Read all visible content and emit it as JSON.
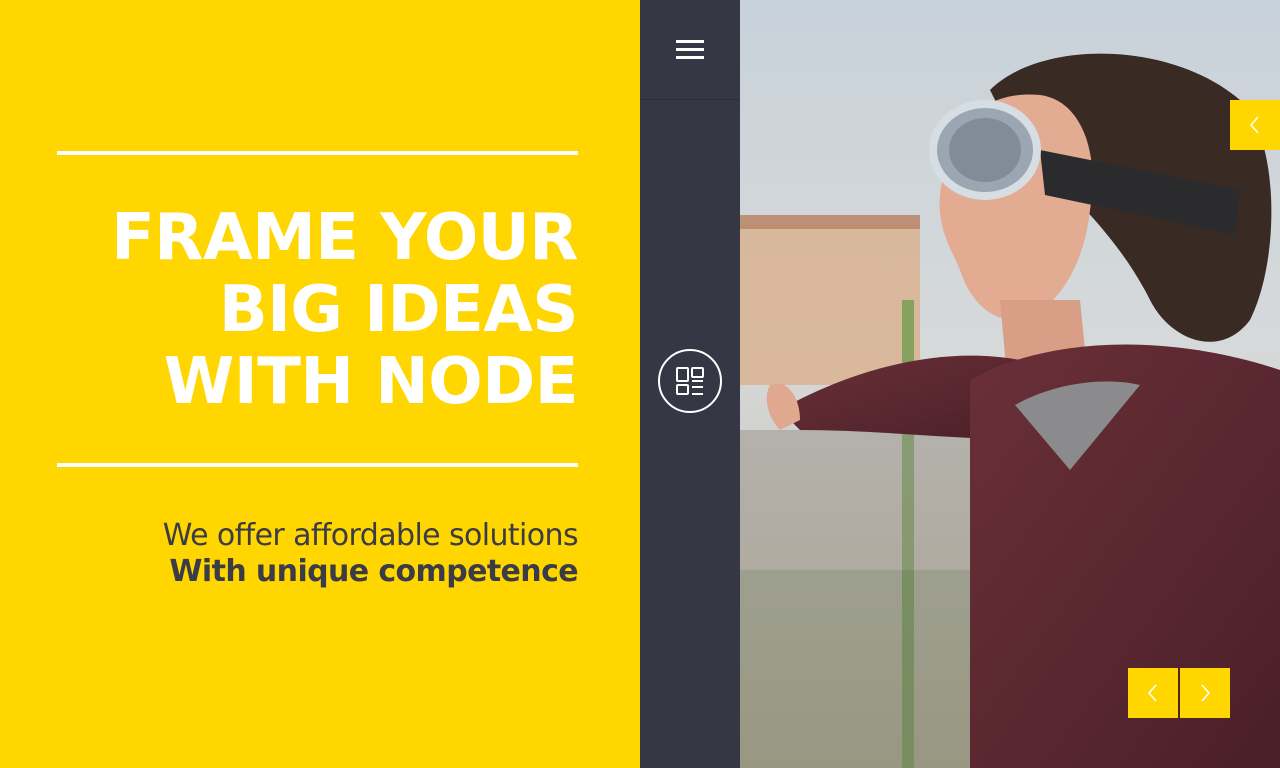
{
  "hero": {
    "headline_lines": [
      "FRAME YOUR",
      "BIG IDEAS",
      "WITH NODE"
    ],
    "tagline_light": "We offer affordable solutions",
    "tagline_bold": "With unique competence"
  },
  "sidebar": {
    "menu_icon": "hamburger-icon",
    "layout_icon": "layout-grid-icon"
  },
  "slider": {
    "image_description_icon": "photo",
    "controls": [
      "prev",
      "next"
    ],
    "top_control": "prev"
  },
  "colors": {
    "accent": "#ffd600",
    "sidebar": "#353844",
    "text_dark": "#3b3c45",
    "white": "#ffffff"
  }
}
